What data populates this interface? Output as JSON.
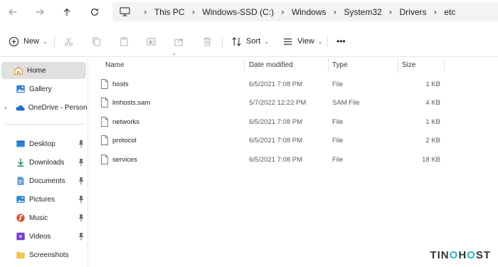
{
  "breadcrumb": [
    "This PC",
    "Windows-SSD (C:)",
    "Windows",
    "System32",
    "Drivers",
    "etc"
  ],
  "toolbar": {
    "new_label": "New",
    "sort_label": "Sort",
    "view_label": "View",
    "more_label": "•••"
  },
  "sidebar": {
    "items": [
      {
        "label": "Home",
        "icon": "home-icon",
        "selected": true
      },
      {
        "label": "Gallery",
        "icon": "gallery-icon"
      },
      {
        "label": "OneDrive - Persona",
        "icon": "onedrive-icon"
      },
      {
        "label": "Desktop",
        "icon": "desktop-icon",
        "pinned": true
      },
      {
        "label": "Downloads",
        "icon": "downloads-icon",
        "pinned": true
      },
      {
        "label": "Documents",
        "icon": "documents-icon",
        "pinned": true
      },
      {
        "label": "Pictures",
        "icon": "pictures-icon",
        "pinned": true
      },
      {
        "label": "Music",
        "icon": "music-icon",
        "pinned": true
      },
      {
        "label": "Videos",
        "icon": "videos-icon",
        "pinned": true
      },
      {
        "label": "Screenshots",
        "icon": "folder-icon"
      }
    ]
  },
  "columns": {
    "name": "Name",
    "date": "Date modified",
    "type": "Type",
    "size": "Size"
  },
  "files": [
    {
      "name": "hosts",
      "date": "6/5/2021 7:08 PM",
      "type": "File",
      "size": "1 KB"
    },
    {
      "name": "lmhosts.sam",
      "date": "5/7/2022 12:22 PM",
      "type": "SAM File",
      "size": "4 KB"
    },
    {
      "name": "networks",
      "date": "6/5/2021 7:08 PM",
      "type": "File",
      "size": "1 KB"
    },
    {
      "name": "protocol",
      "date": "6/5/2021 7:08 PM",
      "type": "File",
      "size": "2 KB"
    },
    {
      "name": "services",
      "date": "6/5/2021 7:08 PM",
      "type": "File",
      "size": "18 KB"
    }
  ],
  "watermark": {
    "part1": "TIN",
    "part2": "O",
    "part3": "H",
    "part4": "O",
    "part5": "ST"
  },
  "colors": {
    "accent": "#0067c0",
    "folder": "#f4c04e",
    "watermark_accent": "#22b5c7"
  }
}
